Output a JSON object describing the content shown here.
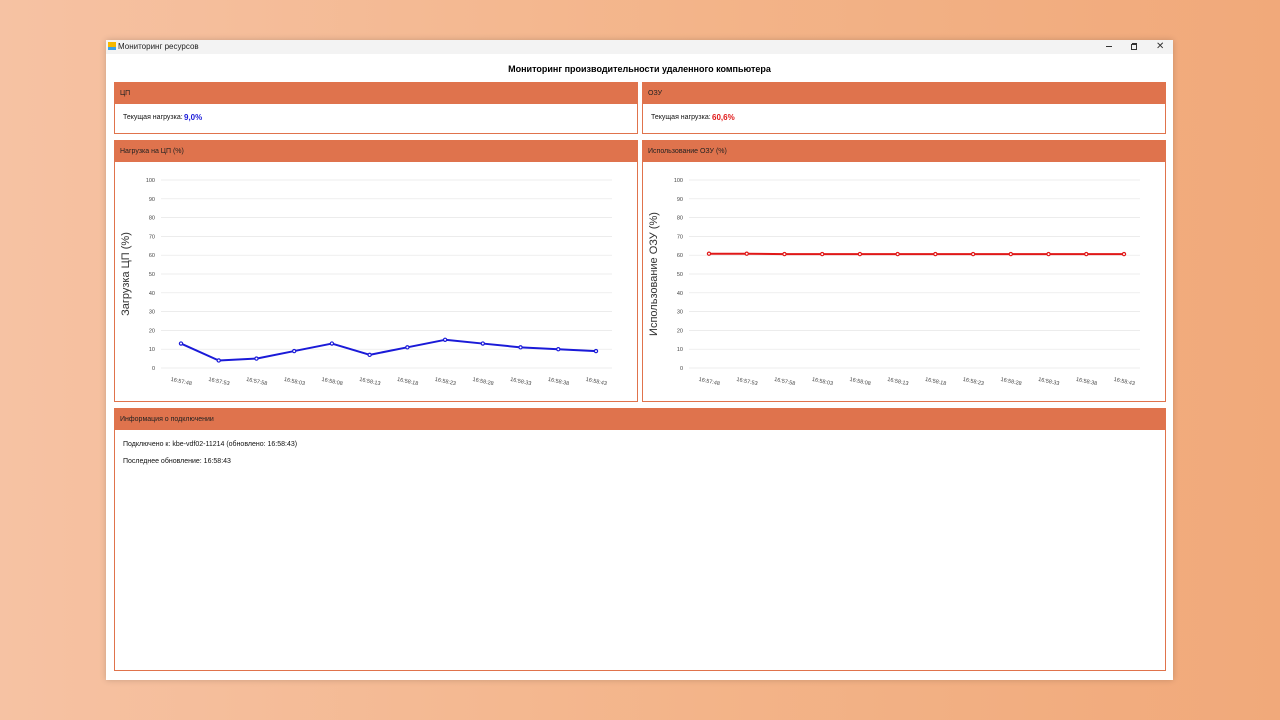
{
  "window": {
    "title": "Мониторинг ресурсов",
    "buttons": {
      "minimize": "minimize-icon",
      "maximize": "restore-icon",
      "close": "close-icon"
    }
  },
  "heading": "Мониторинг производительности удаленного компьютера",
  "cpu": {
    "header": "ЦП",
    "current_label": "Текущая нагрузка:",
    "current_value": "9,0%",
    "value_color": "#1a1ad8"
  },
  "ram": {
    "header": "ОЗУ",
    "current_label": "Текущая нагрузка:",
    "current_value": "60,6%",
    "value_color": "#e01818"
  },
  "cpu_chart": {
    "header": "Нагрузка на ЦП (%)"
  },
  "ram_chart": {
    "header": "Использование ОЗУ (%)"
  },
  "connection": {
    "header": "Информация о подключении",
    "connected_text": "Подключено к: kbe-vdf02-11214 (обновлено: 16:58:43)",
    "last_update_text": "Последнее обновление: 16:58:43"
  },
  "colors": {
    "accent": "#df734d",
    "cpu_series": "#1a1ad8",
    "ram_series": "#e01818"
  },
  "chart_data": [
    {
      "type": "line",
      "title": "Нагрузка на ЦП (%)",
      "xlabel": "",
      "ylabel": "Загрузка ЦП (%)",
      "ylim": [
        0,
        100
      ],
      "yticks": [
        0,
        10,
        20,
        30,
        40,
        50,
        60,
        70,
        80,
        90,
        100
      ],
      "grid": true,
      "categories": [
        "16:57:48",
        "16:57:53",
        "16:57:58",
        "16:58:03",
        "16:58:08",
        "16:58:13",
        "16:58:18",
        "16:58:23",
        "16:58:28",
        "16:58:33",
        "16:58:38",
        "16:58:43"
      ],
      "series": [
        {
          "values": [
            13,
            4,
            5,
            9,
            13,
            7,
            11,
            15,
            13,
            11,
            10,
            9
          ],
          "color": "#1a1ad8"
        }
      ]
    },
    {
      "type": "line",
      "title": "Использование ОЗУ (%)",
      "xlabel": "",
      "ylabel": "Использование ОЗУ (%)",
      "ylim": [
        0,
        100
      ],
      "yticks": [
        0,
        10,
        20,
        30,
        40,
        50,
        60,
        70,
        80,
        90,
        100
      ],
      "grid": true,
      "categories": [
        "16:57:48",
        "16:57:53",
        "16:57:58",
        "16:58:03",
        "16:58:08",
        "16:58:13",
        "16:58:18",
        "16:58:23",
        "16:58:28",
        "16:58:33",
        "16:58:38",
        "16:58:43"
      ],
      "series": [
        {
          "values": [
            60.8,
            60.8,
            60.6,
            60.6,
            60.6,
            60.6,
            60.6,
            60.6,
            60.6,
            60.6,
            60.6,
            60.6
          ],
          "color": "#e01818"
        }
      ]
    }
  ]
}
